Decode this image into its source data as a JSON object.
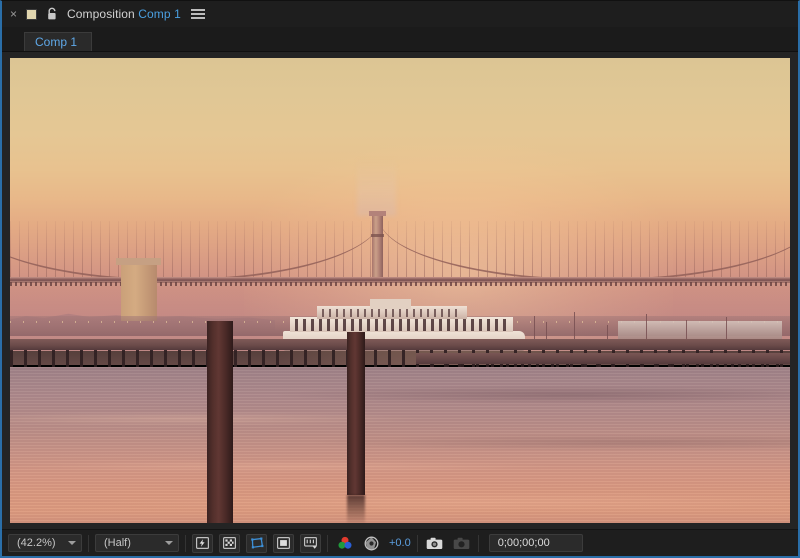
{
  "panel": {
    "close_label": "×",
    "lock_icon": "lock-icon",
    "title_prefix": "Composition",
    "comp_name": "Comp 1",
    "menu_icon": "panel-menu-icon",
    "swatch_color": "#e0d5ae",
    "accent_color": "#4a9fe0",
    "focus_border_color": "#2a6ea8"
  },
  "tabs": [
    {
      "label": "Comp 1",
      "active": true
    }
  ],
  "viewer": {
    "image_description": "San Francisco Bay Bridge at sunset with ferry boat and pier pilings",
    "background": "#242424"
  },
  "toolbar": {
    "zoom": {
      "value": "(42.2%)",
      "icon": "chevron-down-icon"
    },
    "resolution": {
      "value": "(Half)",
      "icon": "chevron-down-icon"
    },
    "buttons": [
      {
        "name": "fast-previews-icon",
        "active": false
      },
      {
        "name": "transparency-grid-icon",
        "active": false
      },
      {
        "name": "region-of-interest-icon",
        "active": true
      },
      {
        "name": "title-action-safe-icon",
        "active": false
      },
      {
        "name": "timeline-view-icon",
        "active": false
      }
    ],
    "channels_icon": "rgb-channels-icon",
    "exposure_icon": "aperture-icon",
    "exposure_value": "+0.0",
    "snapshot_icon": "camera-icon",
    "show_snapshot_icon": "show-snapshot-icon",
    "timecode": "0;00;00;00"
  }
}
